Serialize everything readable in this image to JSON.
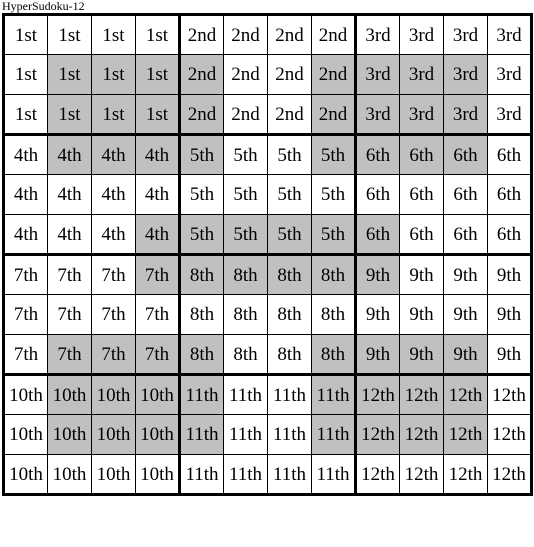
{
  "title": "HyperSudoku-12",
  "colors": {
    "shaded_cell": "#c0c0c0",
    "plain_cell": "#ffffff",
    "grid_line": "#000000",
    "text": "#000000"
  },
  "grid": {
    "rows": 12,
    "cols": 12,
    "block_rows": 3,
    "block_cols": 4,
    "block_labels": [
      "1st",
      "2nd",
      "3rd",
      "4th",
      "5th",
      "6th",
      "7th",
      "8th",
      "9th",
      "10th",
      "11th",
      "12th"
    ],
    "cells": [
      [
        {
          "label": "1st",
          "shaded": false
        },
        {
          "label": "1st",
          "shaded": false
        },
        {
          "label": "1st",
          "shaded": false
        },
        {
          "label": "1st",
          "shaded": false
        },
        {
          "label": "2nd",
          "shaded": false
        },
        {
          "label": "2nd",
          "shaded": false
        },
        {
          "label": "2nd",
          "shaded": false
        },
        {
          "label": "2nd",
          "shaded": false
        },
        {
          "label": "3rd",
          "shaded": false
        },
        {
          "label": "3rd",
          "shaded": false
        },
        {
          "label": "3rd",
          "shaded": false
        },
        {
          "label": "3rd",
          "shaded": false
        }
      ],
      [
        {
          "label": "1st",
          "shaded": false
        },
        {
          "label": "1st",
          "shaded": true
        },
        {
          "label": "1st",
          "shaded": true
        },
        {
          "label": "1st",
          "shaded": true
        },
        {
          "label": "2nd",
          "shaded": true
        },
        {
          "label": "2nd",
          "shaded": false
        },
        {
          "label": "2nd",
          "shaded": false
        },
        {
          "label": "2nd",
          "shaded": true
        },
        {
          "label": "3rd",
          "shaded": true
        },
        {
          "label": "3rd",
          "shaded": true
        },
        {
          "label": "3rd",
          "shaded": true
        },
        {
          "label": "3rd",
          "shaded": false
        }
      ],
      [
        {
          "label": "1st",
          "shaded": false
        },
        {
          "label": "1st",
          "shaded": true
        },
        {
          "label": "1st",
          "shaded": true
        },
        {
          "label": "1st",
          "shaded": true
        },
        {
          "label": "2nd",
          "shaded": true
        },
        {
          "label": "2nd",
          "shaded": false
        },
        {
          "label": "2nd",
          "shaded": false
        },
        {
          "label": "2nd",
          "shaded": true
        },
        {
          "label": "3rd",
          "shaded": true
        },
        {
          "label": "3rd",
          "shaded": true
        },
        {
          "label": "3rd",
          "shaded": true
        },
        {
          "label": "3rd",
          "shaded": false
        }
      ],
      [
        {
          "label": "4th",
          "shaded": false
        },
        {
          "label": "4th",
          "shaded": true
        },
        {
          "label": "4th",
          "shaded": true
        },
        {
          "label": "4th",
          "shaded": true
        },
        {
          "label": "5th",
          "shaded": true
        },
        {
          "label": "5th",
          "shaded": false
        },
        {
          "label": "5th",
          "shaded": false
        },
        {
          "label": "5th",
          "shaded": true
        },
        {
          "label": "6th",
          "shaded": true
        },
        {
          "label": "6th",
          "shaded": true
        },
        {
          "label": "6th",
          "shaded": true
        },
        {
          "label": "6th",
          "shaded": false
        }
      ],
      [
        {
          "label": "4th",
          "shaded": false
        },
        {
          "label": "4th",
          "shaded": false
        },
        {
          "label": "4th",
          "shaded": false
        },
        {
          "label": "4th",
          "shaded": false
        },
        {
          "label": "5th",
          "shaded": false
        },
        {
          "label": "5th",
          "shaded": false
        },
        {
          "label": "5th",
          "shaded": false
        },
        {
          "label": "5th",
          "shaded": false
        },
        {
          "label": "6th",
          "shaded": false
        },
        {
          "label": "6th",
          "shaded": false
        },
        {
          "label": "6th",
          "shaded": false
        },
        {
          "label": "6th",
          "shaded": false
        }
      ],
      [
        {
          "label": "4th",
          "shaded": false
        },
        {
          "label": "4th",
          "shaded": false
        },
        {
          "label": "4th",
          "shaded": false
        },
        {
          "label": "4th",
          "shaded": true
        },
        {
          "label": "5th",
          "shaded": true
        },
        {
          "label": "5th",
          "shaded": true
        },
        {
          "label": "5th",
          "shaded": true
        },
        {
          "label": "5th",
          "shaded": true
        },
        {
          "label": "6th",
          "shaded": true
        },
        {
          "label": "6th",
          "shaded": false
        },
        {
          "label": "6th",
          "shaded": false
        },
        {
          "label": "6th",
          "shaded": false
        }
      ],
      [
        {
          "label": "7th",
          "shaded": false
        },
        {
          "label": "7th",
          "shaded": false
        },
        {
          "label": "7th",
          "shaded": false
        },
        {
          "label": "7th",
          "shaded": true
        },
        {
          "label": "8th",
          "shaded": true
        },
        {
          "label": "8th",
          "shaded": true
        },
        {
          "label": "8th",
          "shaded": true
        },
        {
          "label": "8th",
          "shaded": true
        },
        {
          "label": "9th",
          "shaded": true
        },
        {
          "label": "9th",
          "shaded": false
        },
        {
          "label": "9th",
          "shaded": false
        },
        {
          "label": "9th",
          "shaded": false
        }
      ],
      [
        {
          "label": "7th",
          "shaded": false
        },
        {
          "label": "7th",
          "shaded": false
        },
        {
          "label": "7th",
          "shaded": false
        },
        {
          "label": "7th",
          "shaded": false
        },
        {
          "label": "8th",
          "shaded": false
        },
        {
          "label": "8th",
          "shaded": false
        },
        {
          "label": "8th",
          "shaded": false
        },
        {
          "label": "8th",
          "shaded": false
        },
        {
          "label": "9th",
          "shaded": false
        },
        {
          "label": "9th",
          "shaded": false
        },
        {
          "label": "9th",
          "shaded": false
        },
        {
          "label": "9th",
          "shaded": false
        }
      ],
      [
        {
          "label": "7th",
          "shaded": false
        },
        {
          "label": "7th",
          "shaded": true
        },
        {
          "label": "7th",
          "shaded": true
        },
        {
          "label": "7th",
          "shaded": true
        },
        {
          "label": "8th",
          "shaded": true
        },
        {
          "label": "8th",
          "shaded": false
        },
        {
          "label": "8th",
          "shaded": false
        },
        {
          "label": "8th",
          "shaded": true
        },
        {
          "label": "9th",
          "shaded": true
        },
        {
          "label": "9th",
          "shaded": true
        },
        {
          "label": "9th",
          "shaded": true
        },
        {
          "label": "9th",
          "shaded": false
        }
      ],
      [
        {
          "label": "10th",
          "shaded": false
        },
        {
          "label": "10th",
          "shaded": true
        },
        {
          "label": "10th",
          "shaded": true
        },
        {
          "label": "10th",
          "shaded": true
        },
        {
          "label": "11th",
          "shaded": true
        },
        {
          "label": "11th",
          "shaded": false
        },
        {
          "label": "11th",
          "shaded": false
        },
        {
          "label": "11th",
          "shaded": true
        },
        {
          "label": "12th",
          "shaded": true
        },
        {
          "label": "12th",
          "shaded": true
        },
        {
          "label": "12th",
          "shaded": true
        },
        {
          "label": "12th",
          "shaded": false
        }
      ],
      [
        {
          "label": "10th",
          "shaded": false
        },
        {
          "label": "10th",
          "shaded": true
        },
        {
          "label": "10th",
          "shaded": true
        },
        {
          "label": "10th",
          "shaded": true
        },
        {
          "label": "11th",
          "shaded": true
        },
        {
          "label": "11th",
          "shaded": false
        },
        {
          "label": "11th",
          "shaded": false
        },
        {
          "label": "11th",
          "shaded": true
        },
        {
          "label": "12th",
          "shaded": true
        },
        {
          "label": "12th",
          "shaded": true
        },
        {
          "label": "12th",
          "shaded": true
        },
        {
          "label": "12th",
          "shaded": false
        }
      ],
      [
        {
          "label": "10th",
          "shaded": false
        },
        {
          "label": "10th",
          "shaded": false
        },
        {
          "label": "10th",
          "shaded": false
        },
        {
          "label": "10th",
          "shaded": false
        },
        {
          "label": "11th",
          "shaded": false
        },
        {
          "label": "11th",
          "shaded": false
        },
        {
          "label": "11th",
          "shaded": false
        },
        {
          "label": "11th",
          "shaded": false
        },
        {
          "label": "12th",
          "shaded": false
        },
        {
          "label": "12th",
          "shaded": false
        },
        {
          "label": "12th",
          "shaded": false
        },
        {
          "label": "12th",
          "shaded": false
        }
      ]
    ]
  }
}
